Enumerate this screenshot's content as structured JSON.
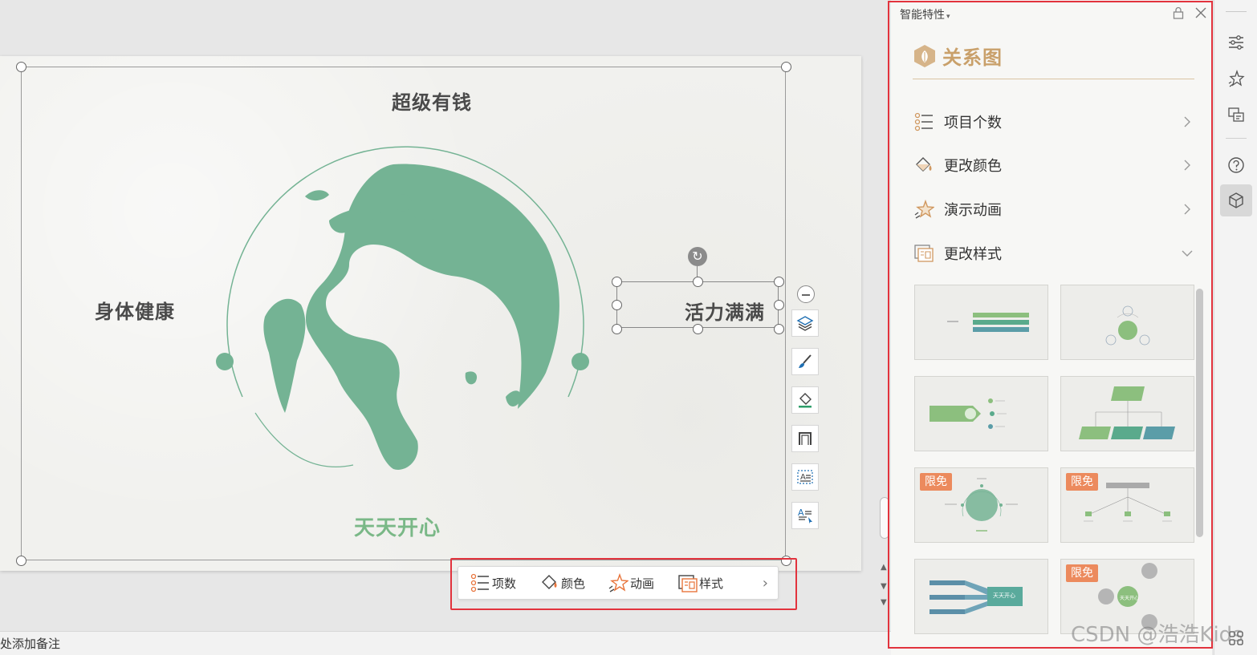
{
  "slide": {
    "nodes": {
      "top": "超级有钱",
      "left": "身体健康",
      "right": "活力满满",
      "bottom": "天天开心"
    },
    "colors": {
      "globe": "#74b394",
      "accent_bottom": "#7ab887"
    }
  },
  "quick_tools": [
    "collapse-icon",
    "layers-icon",
    "brush-icon",
    "fill-icon",
    "frame-icon",
    "text-box-icon",
    "text-style-icon"
  ],
  "context_toolbar": {
    "items": [
      {
        "label": "项数",
        "icon": "list-count-icon"
      },
      {
        "label": "颜色",
        "icon": "paint-bucket-icon"
      },
      {
        "label": "动画",
        "icon": "star-animation-icon"
      },
      {
        "label": "样式",
        "icon": "style-layout-icon"
      }
    ],
    "more_icon": "chevron-right-icon"
  },
  "notes_bar": {
    "text": "处添加备注"
  },
  "panel": {
    "title": "智能特性",
    "section_title": "关系图",
    "menu": [
      {
        "label": "项目个数",
        "icon": "list-count-icon",
        "chevron": "right"
      },
      {
        "label": "更改颜色",
        "icon": "paint-bucket-icon",
        "chevron": "right"
      },
      {
        "label": "演示动画",
        "icon": "star-animation-icon",
        "chevron": "right"
      },
      {
        "label": "更改样式",
        "icon": "style-layout-icon",
        "chevron": "down"
      }
    ],
    "badge_label": "限免",
    "thumb_texts": {
      "center": "天天开心",
      "center_alt": "天天开心"
    },
    "accent_color": "#c9a06a",
    "badge_color": "#ec8a5d"
  },
  "rail": [
    "settings-sliders-icon",
    "star-icon",
    "convert-icon",
    "help-icon",
    "cube-icon",
    "apps-icon"
  ],
  "watermark": "CSDN @浩浩Kids"
}
